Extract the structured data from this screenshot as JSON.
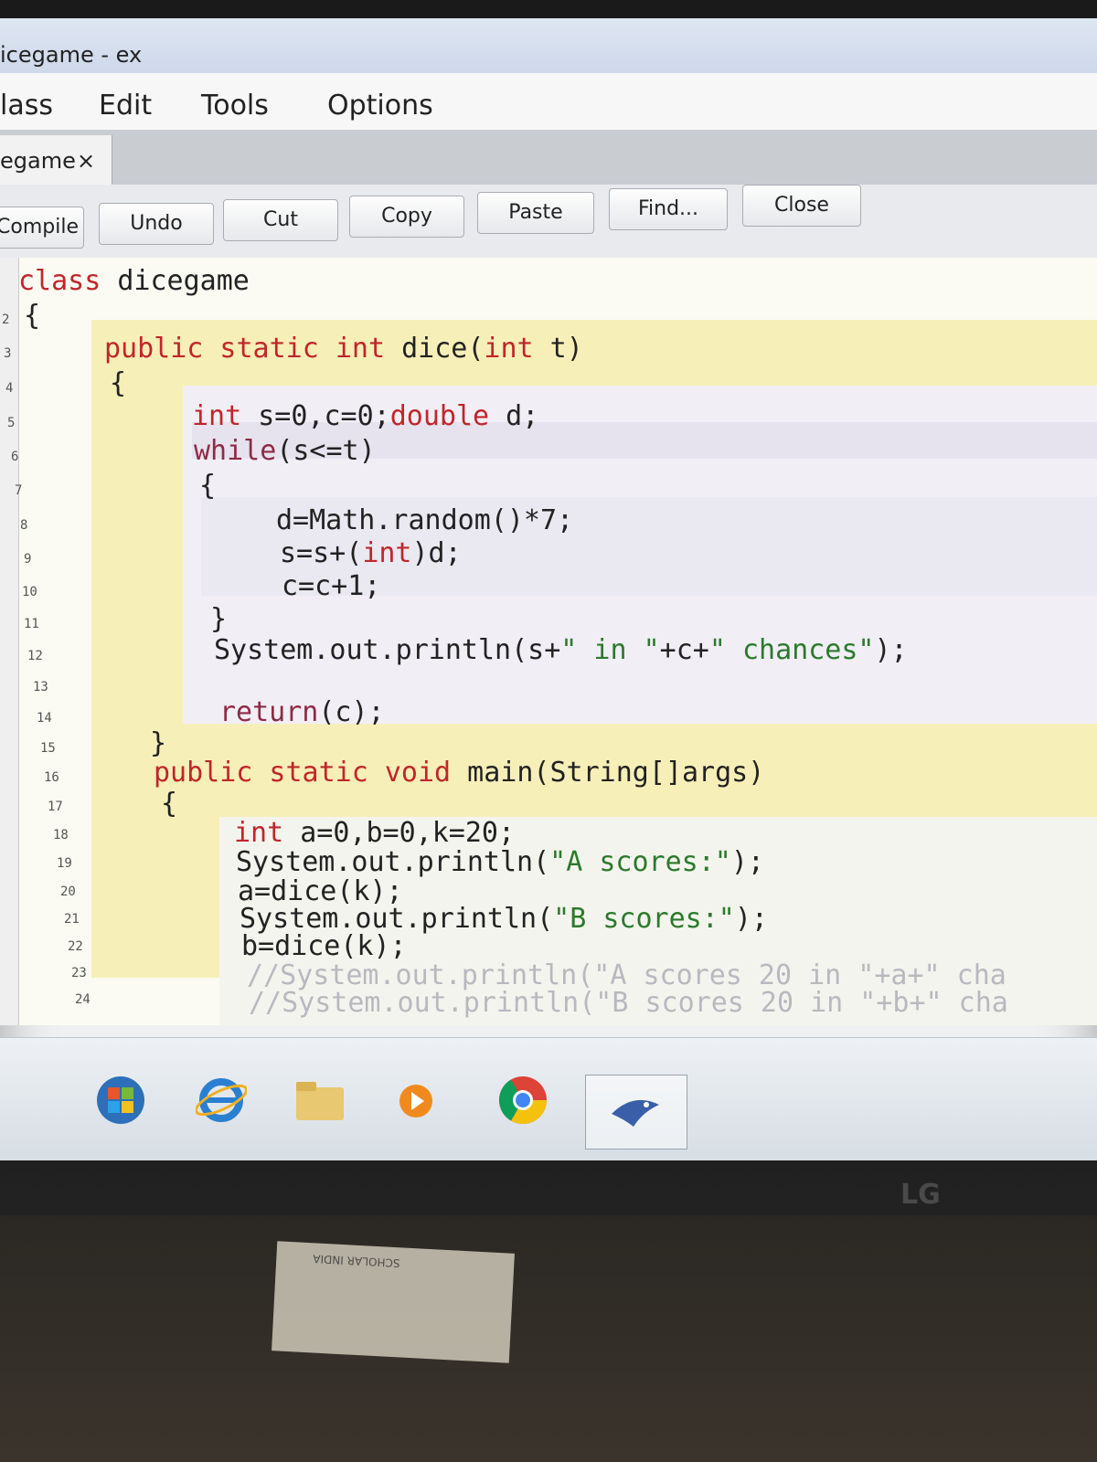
{
  "window": {
    "title": "icegame - ex"
  },
  "menu": {
    "items": [
      "lass",
      "Edit",
      "Tools",
      "Options"
    ]
  },
  "tab": {
    "label": "egame",
    "close_glyph": "×"
  },
  "toolbar": {
    "buttons": [
      "Compile",
      "Undo",
      "Cut",
      "Copy",
      "Paste",
      "Find...",
      "Close"
    ]
  },
  "editor": {
    "line_numbers": [
      "2",
      "3",
      "4",
      "5",
      "6",
      "7",
      "8",
      "9",
      "10",
      "11",
      "12",
      "13",
      "14",
      "15",
      "16",
      "17",
      "18",
      "19",
      "20",
      "21",
      "22",
      "23",
      "24"
    ],
    "code": {
      "l1_kw": "class",
      "l1_rest": " dicegame",
      "l2": "{",
      "l3_kw1": "public static int",
      "l3_mid": " dice(",
      "l3_kw2": "int",
      "l3_end": " t)",
      "l4": "{",
      "l5_kw1": "int",
      "l5_mid": " s=0,c=0;",
      "l5_kw2": "double",
      "l5_end": " d;",
      "l6_kw": "while",
      "l6_rest": "(s<=t)",
      "l7": "{",
      "l8": "d=Math.random()*7;",
      "l9_a": "s=s+(",
      "l9_kw": "int",
      "l9_b": ")d;",
      "l10": "c=c+1;",
      "l11": "}",
      "l12_a": "System.out.println(s+",
      "l12_str1": "\" in \"",
      "l12_b": "+c+",
      "l12_str2": "\" chances\"",
      "l12_c": ");",
      "l14_kw": "return",
      "l14_rest": "(c);",
      "l15": "}",
      "l16_kw": "public static void",
      "l16_rest": " main(String[]args)",
      "l17": "{",
      "l18_kw": "int",
      "l18_rest": " a=0,b=0,k=20;",
      "l19_a": "System.out.println(",
      "l19_str": "\"A scores:\"",
      "l19_b": ");",
      "l20": "a=dice(k);",
      "l21_a": "System.out.println(",
      "l21_str": "\"B scores:\"",
      "l21_b": ");",
      "l22": "b=dice(k);",
      "l23": "//System.out.println(\"A scores 20 in \"+a+\" cha",
      "l24": "//System.out.println(\"B scores 20 in \"+b+\" cha"
    }
  },
  "taskbar": {
    "icons": [
      "windows-start-icon",
      "internet-explorer-icon",
      "file-explorer-icon",
      "media-player-icon",
      "chrome-icon",
      "bluej-icon"
    ]
  },
  "monitor": {
    "brand": "LG"
  },
  "desk_card": {
    "text": "SCHOLAR INDIA"
  }
}
